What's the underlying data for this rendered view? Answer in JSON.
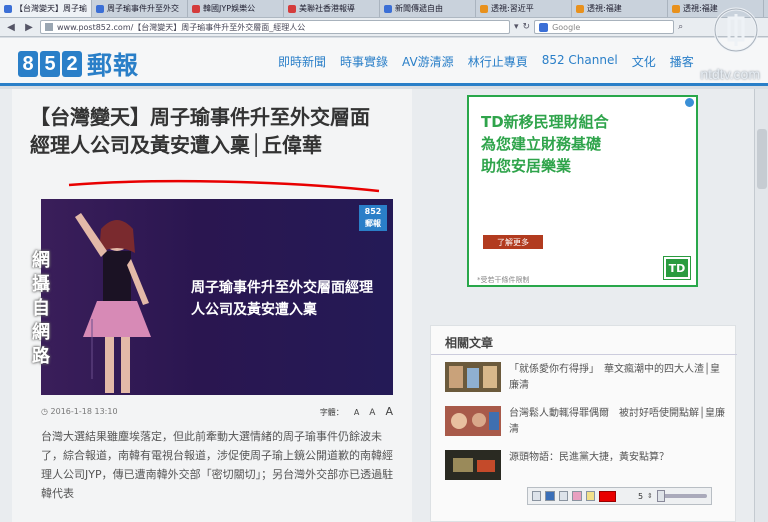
{
  "browser": {
    "tabs": [
      {
        "label": "【台灣變天】周子瑜",
        "color": "#3b6fd6",
        "active": true
      },
      {
        "label": "周子瑜事件升至外交",
        "color": "#3b6fd6",
        "active": false
      },
      {
        "label": "韓國JYP娛樂公",
        "color": "#d43c3c",
        "active": false
      },
      {
        "label": "美聯社香港報導",
        "color": "#d43c3c",
        "active": false
      },
      {
        "label": "新聞傳遞自由",
        "color": "#3b6fd6",
        "active": false
      },
      {
        "label": "透視:習近平",
        "color": "#e8911d",
        "active": false
      },
      {
        "label": "透視:福建",
        "color": "#e8911d",
        "active": false
      },
      {
        "label": "透視:福建",
        "color": "#e8911d",
        "active": false
      }
    ],
    "url": "www.post852.com/【台灣變天】周子瑜事件升至外交層面_經理人公",
    "search_placeholder": "Google"
  },
  "site": {
    "logo_digits": [
      "8",
      "5",
      "2"
    ],
    "logo_text": "郵報",
    "nav": [
      "即時新聞",
      "時事實錄",
      "AV游清源",
      "林行止專頁",
      "852 Channel",
      "文化",
      "播客"
    ],
    "watermark": "ntdtv.com"
  },
  "article": {
    "headline": "【台灣變天】周子瑜事件升至外交層面　經理人公司及黃安遭入稟│丘偉華",
    "hero_caption": "周子瑜事件升至外交層面經理人公司及黃安遭入稟",
    "hero_logo_top": "852",
    "hero_logo_bottom": "郵報",
    "side_overlay": "網攝自網路",
    "date": "2016-1-18  13:10",
    "fontsize_label": "字體：",
    "fontsize_options": [
      "A",
      "A",
      "A"
    ],
    "body": "台灣大選結果雖塵埃落定，但此前牽動大選情緒的周子瑜事件仍餘波未了，綜合報道，南韓有電視台報道，涉促使周子瑜上鏡公開道歉的南韓經理人公司JYP，傳已遭南韓外交部「密切關切」；另台灣外交部亦已透過駐韓代表"
  },
  "ad": {
    "lines": [
      "TD新移民理財組合",
      "為您建立財務基礎",
      "助您安居樂業"
    ],
    "button": "了解更多",
    "fine_print": "*受若干條件限制",
    "logo": "TD"
  },
  "related": {
    "title": "相關文章",
    "items": [
      {
        "text": "「就係愛你冇得掙」　華文瘋潮中的四大人渣│皇廉清"
      },
      {
        "text": "台灣鬆人動輒得罪偶爾　被討好唔使開點解│皇廉清"
      },
      {
        "text": "源頭物語：民進黨大捷，黃安點算？"
      }
    ]
  },
  "tool": {
    "number": "5"
  },
  "colors": {
    "brand_blue": "#2a7fc8",
    "ad_green": "#2fa44b",
    "annotation_red": "#e80000"
  }
}
